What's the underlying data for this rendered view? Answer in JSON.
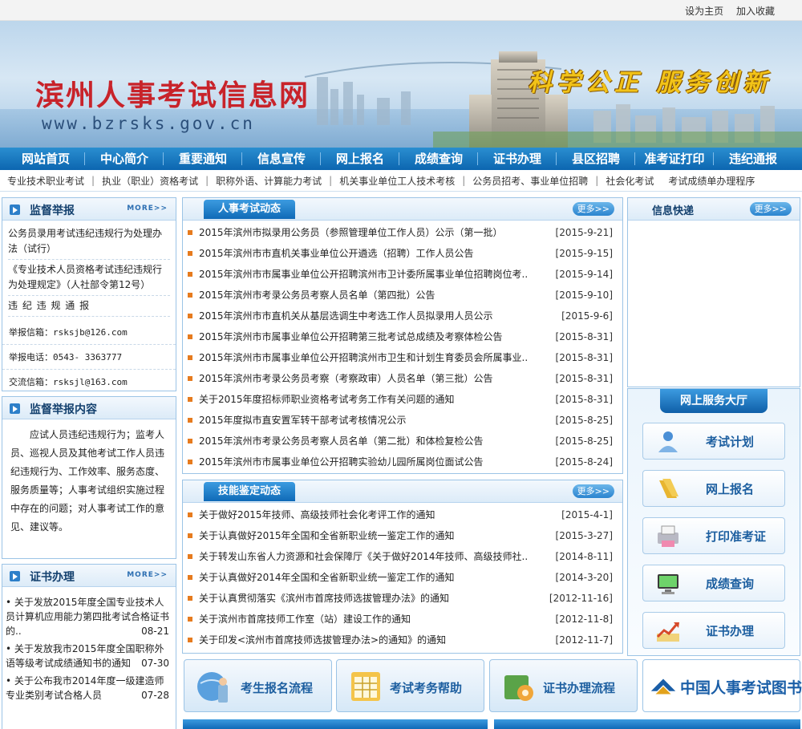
{
  "topbar": {
    "set_home": "设为主页",
    "add_fav": "加入收藏"
  },
  "banner": {
    "title": "滨州人事考试信息网",
    "url": "www.bzrsks.gov.cn",
    "slogan": "科学公正 服务创新"
  },
  "nav": [
    "网站首页",
    "中心简介",
    "重要通知",
    "信息宣传",
    "网上报名",
    "成绩查询",
    "证书办理",
    "县区招聘",
    "准考证打印",
    "违纪通报"
  ],
  "subnav": [
    "专业技术职业考试",
    "执业（职业）资格考试",
    "职称外语、计算能力考试",
    "机关事业单位工人技术考核",
    "公务员招考、事业单位招聘",
    "社会化考试",
    "考试成绩单办理程序"
  ],
  "panel_jdjb": {
    "title": "监督举报",
    "more": "MORE>>",
    "lines": [
      "公务员录用考试违纪违规行为处理办法（试行）",
      "《专业技术人员资格考试违纪违规行为处理规定》（人社部令第12号）",
      "违 纪 违 规 通 报"
    ],
    "contacts": [
      "举报信箱：rsksjb@126.com",
      "举报电话：0543- 3363777",
      "交流信箱：rsksjl@163.com"
    ]
  },
  "panel_jbnr": {
    "title": "监督举报内容",
    "text": "应试人员违纪违规行为；监考人员、巡视人员及其他考试工作人员违纪违规行为、工作效率、服务态度、服务质量等；人事考试组织实施过程中存在的问题；对人事考试工作的意见、建议等。"
  },
  "panel_zsbl": {
    "title": "证书办理",
    "more": "MORE>>",
    "items": [
      {
        "text": "关于发放2015年度全国专业技术人员计算机应用能力第四批考试合格证书的..",
        "date": "08-21"
      },
      {
        "text": "关于发放我市2015年度全国职称外语等级考试成绩通知书的通知",
        "date": "07-30"
      },
      {
        "text": "关于公布我市2014年度一级建造师专业类别考试合格人员",
        "date": "07-28"
      }
    ]
  },
  "panel_rsks": {
    "title": "人事考试动态",
    "more": "更多>>",
    "rows": [
      {
        "text": "2015年滨州市拟录用公务员（参照管理单位工作人员）公示（第一批）",
        "date": "[2015-9-21]"
      },
      {
        "text": "2015年滨州市市直机关事业单位公开遴选（招聘）工作人员公告",
        "date": "[2015-9-15]"
      },
      {
        "text": "2015年滨州市市属事业单位公开招聘滨州市卫计委所属事业单位招聘岗位考..",
        "date": "[2015-9-14]"
      },
      {
        "text": "2015年滨州市考录公务员考察人员名单（第四批）公告",
        "date": "[2015-9-10]"
      },
      {
        "text": "2015年滨州市市直机关从基层选调生中考选工作人员拟录用人员公示",
        "date": "[2015-9-6]"
      },
      {
        "text": "2015年滨州市市属事业单位公开招聘第三批考试总成绩及考察体检公告",
        "date": "[2015-8-31]"
      },
      {
        "text": "2015年滨州市市属事业单位公开招聘滨州市卫生和计划生育委员会所属事业..",
        "date": "[2015-8-31]"
      },
      {
        "text": "2015年滨州市考录公务员考察（考察政审）人员名单（第三批）公告",
        "date": "[2015-8-31]"
      },
      {
        "text": "关于2015年度招标师职业资格考试考务工作有关问题的通知",
        "date": "[2015-8-31]"
      },
      {
        "text": "2015年度拟市直安置军转干部考试考核情况公示",
        "date": "[2015-8-25]"
      },
      {
        "text": "2015年滨州市考录公务员考察人员名单（第二批）和体检复检公告",
        "date": "[2015-8-25]"
      },
      {
        "text": "2015年滨州市市属事业单位公开招聘实验幼儿园所属岗位面试公告",
        "date": "[2015-8-24]"
      }
    ]
  },
  "panel_jnjd": {
    "title": "技能鉴定动态",
    "more": "更多>>",
    "rows": [
      {
        "text": "关于做好2015年技师、高级技师社会化考评工作的通知",
        "date": "[2015-4-1]"
      },
      {
        "text": "关于认真做好2015年全国和全省新职业统一鉴定工作的通知",
        "date": "[2015-3-27]"
      },
      {
        "text": "关于转发山东省人力资源和社会保障厅《关于做好2014年技师、高级技师社..",
        "date": "[2014-8-11]"
      },
      {
        "text": "关于认真做好2014年全国和全省新职业统一鉴定工作的通知",
        "date": "[2014-3-20]"
      },
      {
        "text": "关于认真贯彻落实《滨州市首席技师选拔管理办法》的通知",
        "date": "[2012-11-16]"
      },
      {
        "text": "关于滨州市首席技师工作室（站）建设工作的通知",
        "date": "[2012-11-8]"
      },
      {
        "text": "关于印发<滨州市首席技师选拔管理办法>的通知》的通知",
        "date": "[2012-11-7]"
      }
    ]
  },
  "panel_xxkd": {
    "title": "信息快递",
    "more": "更多>>"
  },
  "panel_fwdt": {
    "title": "网上服务大厅",
    "buttons": [
      "考试计划",
      "网上报名",
      "打印准考证",
      "成绩查询",
      "证书办理"
    ]
  },
  "bottom_buttons": [
    "考生报名流程",
    "考试考务帮助",
    "证书办理流程"
  ],
  "library_label": "中国人事考试图书网",
  "colors": {
    "nav_blue": "#0c66b0",
    "title_red": "#c8232a",
    "slogan_gold": "#f2c318",
    "bullet_orange": "#e67b1e"
  }
}
